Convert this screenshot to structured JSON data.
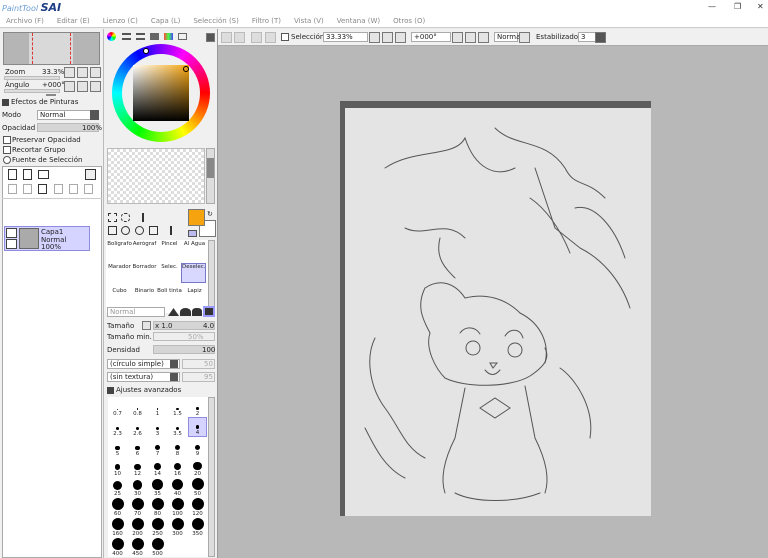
{
  "app": {
    "logo_text": "PaintTool",
    "logo_sai": "SAI"
  },
  "window_controls": [
    "—",
    "❐",
    "✕"
  ],
  "menu": [
    {
      "label": "Archivo (F)"
    },
    {
      "label": "Editar (E)"
    },
    {
      "label": "Lienzo (C)"
    },
    {
      "label": "Capa (L)"
    },
    {
      "label": "Selección (S)"
    },
    {
      "label": "Filtro (T)"
    },
    {
      "label": "Vista (V)"
    },
    {
      "label": "Ventana (W)"
    },
    {
      "label": "Otros (O)"
    }
  ],
  "navigator": {
    "zoom_label": "Zoom",
    "zoom_value": "33.3%",
    "angle_label": "Ángulo",
    "angle_value": "+000°"
  },
  "layer_effects": {
    "title": "Efectos de Pinturas",
    "mode_label": "Modo",
    "mode_value": "Normal",
    "opacity_label": "Opacidad",
    "opacity_value": "100%",
    "preserve_opacity": "Preservar Opacidad",
    "clip_group": "Recortar Grupo",
    "selection_source": "Fuente de Selección"
  },
  "layer": {
    "name": "Capa1",
    "mode": "Normal",
    "opacity": "100%"
  },
  "canvas_toolbar": {
    "selection_label": "Selección",
    "zoom_value": "33.33%",
    "angle_value": "+000°",
    "blend_value": "Normal",
    "stabilizer_label": "Estabilizador",
    "stabilizer_value": "3"
  },
  "colors": {
    "primary": "#f5a40f",
    "secondary": "#ffffff",
    "layer_highlight": "#d5d3ff",
    "canvas_bg": "#b8b8b8"
  },
  "tools": [
    {
      "label": "Bolígrafo"
    },
    {
      "label": "Aerógraf"
    },
    {
      "label": "Pincel"
    },
    {
      "label": "Al Agua"
    },
    {
      "label": "Marador"
    },
    {
      "label": "Borrador"
    },
    {
      "label": "Selec."
    },
    {
      "label": "Deselec."
    },
    {
      "label": "Cubo"
    },
    {
      "label": "Binario"
    },
    {
      "label": "Boli tinta"
    },
    {
      "label": "Lapiz"
    }
  ],
  "brush": {
    "blend_value": "Normal",
    "size_label": "Tamaño",
    "size_multiplier": "x 1.0",
    "size_value": "4.0",
    "min_size_label": "Tamaño min.",
    "min_size_value": "50%",
    "density_label": "Densidad",
    "density_value": "100",
    "shape_value": "(círculo simple)",
    "shape_amount": "50",
    "texture_value": "(sin textura)",
    "texture_amount": "95",
    "advanced_label": "Ajustes avanzados"
  },
  "brush_sizes": [
    {
      "label": "0.7"
    },
    {
      "label": "0.8"
    },
    {
      "label": "1"
    },
    {
      "label": "1.5"
    },
    {
      "label": "2"
    },
    {
      "label": "2.3"
    },
    {
      "label": "2.6"
    },
    {
      "label": "3"
    },
    {
      "label": "3.5"
    },
    {
      "label": "4"
    },
    {
      "label": "5"
    },
    {
      "label": "6"
    },
    {
      "label": "7"
    },
    {
      "label": "8"
    },
    {
      "label": "9"
    },
    {
      "label": "10"
    },
    {
      "label": "12"
    },
    {
      "label": "14"
    },
    {
      "label": "16"
    },
    {
      "label": "20"
    },
    {
      "label": "25"
    },
    {
      "label": "30"
    },
    {
      "label": "35"
    },
    {
      "label": "40"
    },
    {
      "label": "50"
    },
    {
      "label": "60"
    },
    {
      "label": "70"
    },
    {
      "label": "80"
    },
    {
      "label": "100"
    },
    {
      "label": "120"
    },
    {
      "label": "160"
    },
    {
      "label": "200"
    },
    {
      "label": "250"
    },
    {
      "label": "300"
    },
    {
      "label": "350"
    },
    {
      "label": "400"
    },
    {
      "label": "450"
    },
    {
      "label": "500"
    }
  ],
  "selected_brush_size": "4"
}
